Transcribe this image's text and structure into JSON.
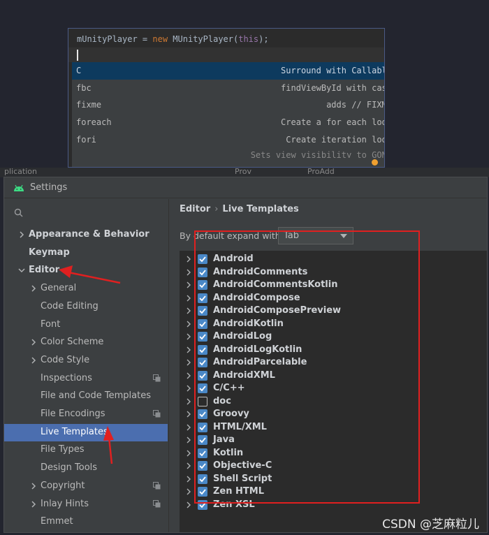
{
  "editor": {
    "code": {
      "var": "mUnityPlayer",
      "op": " = ",
      "kw": "new",
      "cls": " MUnityPlayer(",
      "param": "this",
      "end": ");"
    },
    "completions": [
      {
        "abbr": "C",
        "desc": "Surround with Callable",
        "selected": true
      },
      {
        "abbr": "fbc",
        "desc": "findViewById with cast",
        "selected": false
      },
      {
        "abbr": "fixme",
        "desc": "adds // FIXME",
        "selected": false
      },
      {
        "abbr": "foreach",
        "desc": "Create a for each loop",
        "selected": false
      },
      {
        "abbr": "fori",
        "desc": "Create iteration loop",
        "selected": false
      }
    ],
    "partial_row": "Sets view visibility to GONE"
  },
  "behind_window": {
    "t1": "plication",
    "t2": "Prov",
    "t3": "ProAdd"
  },
  "settings": {
    "title": "Settings",
    "search_placeholder": "Q-",
    "nav": [
      {
        "label": "Appearance & Behavior",
        "bold": true,
        "chevron": "right",
        "indent": 0
      },
      {
        "label": "Keymap",
        "bold": true,
        "chevron": "none",
        "indent": 0
      },
      {
        "label": "Editor",
        "bold": true,
        "chevron": "down",
        "indent": 0
      },
      {
        "label": "General",
        "bold": false,
        "chevron": "right",
        "indent": 1
      },
      {
        "label": "Code Editing",
        "bold": false,
        "chevron": "none",
        "indent": 1
      },
      {
        "label": "Font",
        "bold": false,
        "chevron": "none",
        "indent": 1
      },
      {
        "label": "Color Scheme",
        "bold": false,
        "chevron": "right",
        "indent": 1
      },
      {
        "label": "Code Style",
        "bold": false,
        "chevron": "right",
        "indent": 1
      },
      {
        "label": "Inspections",
        "bold": false,
        "chevron": "none",
        "indent": 1,
        "copy_icon": true
      },
      {
        "label": "File and Code Templates",
        "bold": false,
        "chevron": "none",
        "indent": 1
      },
      {
        "label": "File Encodings",
        "bold": false,
        "chevron": "none",
        "indent": 1,
        "copy_icon": true
      },
      {
        "label": "Live Templates",
        "bold": false,
        "chevron": "none",
        "indent": 1,
        "selected": true
      },
      {
        "label": "File Types",
        "bold": false,
        "chevron": "none",
        "indent": 1
      },
      {
        "label": "Design Tools",
        "bold": false,
        "chevron": "none",
        "indent": 1
      },
      {
        "label": "Copyright",
        "bold": false,
        "chevron": "right",
        "indent": 1,
        "copy_icon": true
      },
      {
        "label": "Inlay Hints",
        "bold": false,
        "chevron": "right",
        "indent": 1,
        "copy_icon": true
      },
      {
        "label": "Emmet",
        "bold": false,
        "chevron": "none",
        "indent": 1
      }
    ],
    "breadcrumb": [
      "Editor",
      "Live Templates"
    ],
    "breadcrumb_sep": "›",
    "expand_label": "By default expand with",
    "expand_value": "Tab",
    "template_groups": [
      {
        "name": "Android",
        "checked": true
      },
      {
        "name": "AndroidComments",
        "checked": true
      },
      {
        "name": "AndroidCommentsKotlin",
        "checked": true
      },
      {
        "name": "AndroidCompose",
        "checked": true
      },
      {
        "name": "AndroidComposePreview",
        "checked": true
      },
      {
        "name": "AndroidKotlin",
        "checked": true
      },
      {
        "name": "AndroidLog",
        "checked": true
      },
      {
        "name": "AndroidLogKotlin",
        "checked": true
      },
      {
        "name": "AndroidParcelable",
        "checked": true
      },
      {
        "name": "AndroidXML",
        "checked": true
      },
      {
        "name": "C/C++",
        "checked": true
      },
      {
        "name": "doc",
        "checked": false
      },
      {
        "name": "Groovy",
        "checked": true
      },
      {
        "name": "HTML/XML",
        "checked": true
      },
      {
        "name": "Java",
        "checked": true
      },
      {
        "name": "Kotlin",
        "checked": true
      },
      {
        "name": "Objective-C",
        "checked": true
      },
      {
        "name": "Shell Script",
        "checked": true
      },
      {
        "name": "Zen HTML",
        "checked": true
      },
      {
        "name": "Zen XSL",
        "checked": true
      }
    ]
  },
  "watermark": "CSDN @芝麻粒儿",
  "colors": {
    "accent_selected": "#4b6eaf",
    "checkbox": "#4a88c7",
    "annotation_red": "#e02020"
  }
}
